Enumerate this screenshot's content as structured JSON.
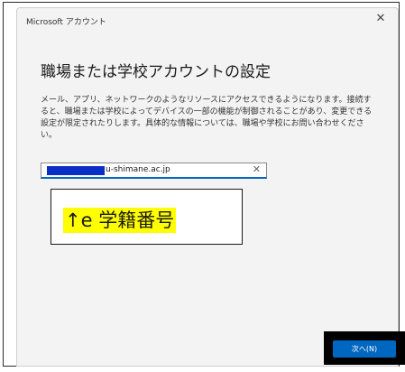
{
  "window": {
    "title": "Microsoft アカウント",
    "close_glyph": "✕"
  },
  "main": {
    "heading": "職場または学校アカウントの設定",
    "description": "メール、アプリ、ネットワークのようなリソースにアクセスできるようになります。接続すると、職場または学校によってデバイスの一部の機能が制御されることがあり、変更できる設定が限定されたりします。具体的な情報については、職場や学校にお問い合わせください。",
    "email_input": {
      "value": "u-shimane.ac.jp",
      "clear_glyph": "✕"
    }
  },
  "annotation": {
    "text": "↑e 学籍番号"
  },
  "footer": {
    "next_label": "次へ(N)"
  },
  "colors": {
    "accent": "#0067c0",
    "redaction": "#0c2ec8",
    "highlight": "#ffff00"
  }
}
